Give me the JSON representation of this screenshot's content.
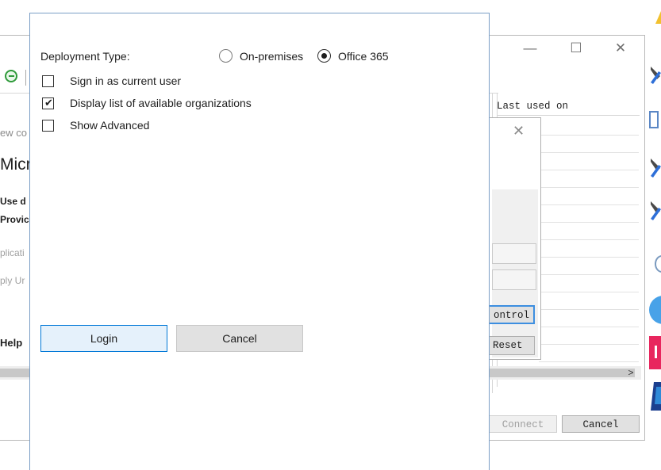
{
  "background_window": {
    "grid_header": "Last used on",
    "connect_label": "Connect",
    "cancel_label": "Cancel",
    "scroll_arrow": ">",
    "min_glyph": "—",
    "max_glyph": "☐",
    "close_glyph": "✕",
    "fragments": {
      "f1": "ew co",
      "f2": "Micr",
      "f3": "Use d",
      "f4": "Provic",
      "f5": "plicati",
      "f6": "ply Ur",
      "f7": "Help"
    }
  },
  "inner_dialog": {
    "close_glyph": "✕",
    "control_label": "ontrol",
    "reset_label": "Reset"
  },
  "login_dialog": {
    "deployment_type_label": "Deployment Type:",
    "option_onprem": "On-premises",
    "option_o365": "Office 365",
    "selected_option": "Office 365",
    "sign_in_current_user": {
      "label": "Sign in as current user",
      "checked": false
    },
    "display_orgs": {
      "label": "Display list of available organizations",
      "checked": true
    },
    "show_advanced": {
      "label": "Show Advanced",
      "checked": false
    },
    "login_label": "Login",
    "cancel_label": "Cancel",
    "checkmark_glyph": "✔"
  },
  "side_icons": [
    "tool-icon",
    "document-icon",
    "tool-icon",
    "tool-icon",
    "globe-icon",
    "twitter-icon",
    "pink-app-icon",
    "paypal-icon",
    "yellow-app-icon"
  ],
  "colors": {
    "accent": "#0078d7",
    "dialog_border": "#7a9ec6",
    "button_bg": "#e1e1e1"
  }
}
